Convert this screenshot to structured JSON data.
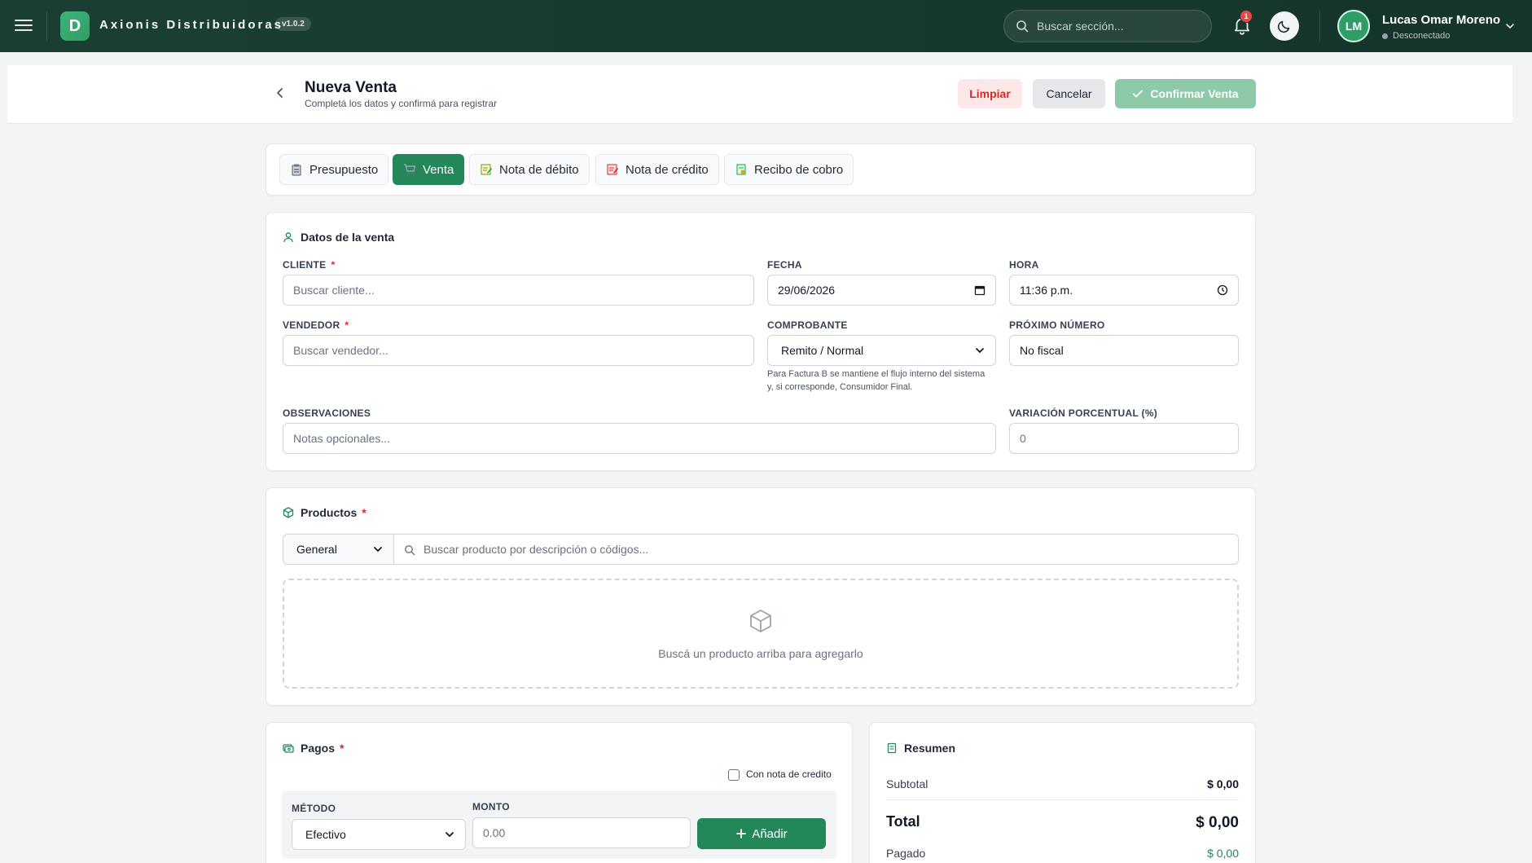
{
  "topbar": {
    "brand": "Axionis Distribuidoras",
    "logo_letter": "D",
    "version": "v1.0.2",
    "search_placeholder": "Buscar sección...",
    "notification_count": "1",
    "user_initials": "LM",
    "user_name": "Lucas Omar Moreno",
    "user_status": "Desconectado"
  },
  "header": {
    "title": "Nueva Venta",
    "subtitle": "Completá los datos y confirmá para registrar",
    "limpiar_label": "Limpiar",
    "cancelar_label": "Cancelar",
    "confirmar_label": "Confirmar Venta"
  },
  "tabs": [
    {
      "label": "Presupuesto",
      "icon": "clipboard-icon"
    },
    {
      "label": "Venta",
      "icon": "cart-icon"
    },
    {
      "label": "Nota de débito",
      "icon": "memo-icon"
    },
    {
      "label": "Nota de crédito",
      "icon": "memo-icon"
    },
    {
      "label": "Recibo de cobro",
      "icon": "receipt-icon"
    }
  ],
  "datos": {
    "title": "Datos de la venta",
    "cliente_label": "CLIENTE",
    "cliente_placeholder": "Buscar cliente...",
    "fecha_label": "FECHA",
    "fecha_value": "29/06/2026",
    "hora_label": "HORA",
    "hora_value": "11:36 p.m.",
    "vendedor_label": "VENDEDOR",
    "vendedor_placeholder": "Buscar vendedor...",
    "comprobante_label": "COMPROBANTE",
    "comprobante_value": "Remito / Normal",
    "comprobante_help": "Para Factura B se mantiene el flujo interno del sistema y, si corresponde, Consumidor Final.",
    "proximo_label": "PRÓXIMO NÚMERO",
    "proximo_value": "No fiscal",
    "observaciones_label": "OBSERVACIONES",
    "observaciones_placeholder": "Notas opcionales...",
    "variacion_label": "VARIACIÓN PORCENTUAL (%)",
    "variacion_placeholder": "0"
  },
  "productos": {
    "title": "Productos",
    "lista_value": "General",
    "search_placeholder": "Buscar producto por descripción o códigos...",
    "empty_text": "Buscá un producto arriba para agregarlo"
  },
  "pagos": {
    "title": "Pagos",
    "nota_credito_label": "Con nota de credito",
    "metodo_label": "MÉTODO",
    "metodo_value": "Efectivo",
    "monto_label": "MONTO",
    "monto_placeholder": "0.00",
    "add_label": "Añadir"
  },
  "resumen": {
    "title": "Resumen",
    "subtotal_label": "Subtotal",
    "subtotal_value": "$ 0,00",
    "total_label": "Total",
    "total_value": "$ 0,00",
    "pagado_label": "Pagado",
    "pagado_value": "$ 0,00"
  },
  "colors": {
    "primary": "#23875a",
    "topbar": "#1b3f33",
    "danger": "#dc2626"
  }
}
